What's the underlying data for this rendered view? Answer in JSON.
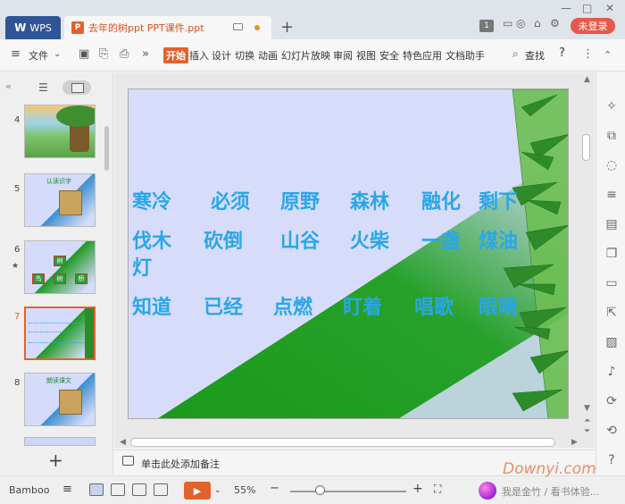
{
  "titlebar": {
    "wps_tab": "WPS",
    "doc_tab": "去年的树ppt PPT课件.ppt",
    "login_button": "未登录",
    "badge": "1"
  },
  "menubar": {
    "file": "文件",
    "tabs": [
      "开始",
      "插入",
      "设计",
      "切换",
      "动画",
      "幻灯片放映",
      "审阅",
      "视图",
      "安全",
      "特色应用",
      "文档助手"
    ],
    "search": "查找",
    "help": "?"
  },
  "slides_panel": {
    "numbers": [
      "4",
      "5",
      "6",
      "7",
      "8"
    ],
    "selected": "7",
    "slide5_title": "认读识字",
    "slide6_labels": [
      "树",
      "鸟",
      "树",
      "桥"
    ],
    "slide8_title": "朗读课文"
  },
  "slide": {
    "rows": [
      [
        "寒冷",
        "必须",
        "原野",
        "森林",
        "融化",
        "剩下"
      ],
      [
        "伐木",
        "砍倒",
        "山谷",
        "火柴",
        "一盏",
        "煤油"
      ],
      [
        "灯"
      ],
      [
        "知道",
        "已经",
        "点燃",
        "盯着",
        "唱歌",
        "眼睛"
      ]
    ],
    "text_color": "#2aa6e8"
  },
  "notes": {
    "placeholder": "单击此处添加备注"
  },
  "statusbar": {
    "theme": "Bamboo",
    "zoom": "55%",
    "blurred_text": "我是金竹 / 看书体验..."
  },
  "watermark": "Downyi.com"
}
